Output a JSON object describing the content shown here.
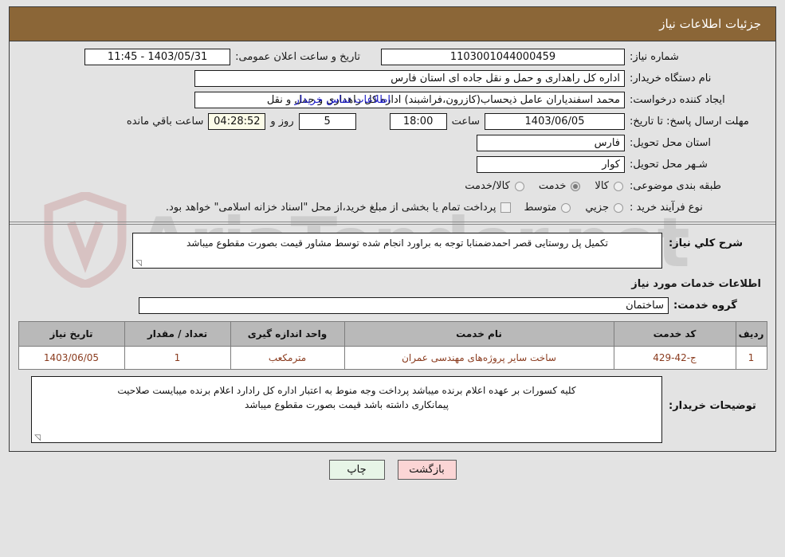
{
  "window": {
    "title": "جزئیات اطلاعات نیاز"
  },
  "info": {
    "need_number_label": "شماره نیاز:",
    "need_number_value": "1103001044000459",
    "public_announce_label": "تاریخ و ساعت اعلان عمومی:",
    "public_announce_value": "11:45 - 1403/05/31",
    "buyer_org_label": "نام دستگاه خریدار:",
    "buyer_org_value": "اداره کل راهداری و حمل و نقل جاده ای استان فارس",
    "requester_label": "ایجاد کننده درخواست:",
    "requester_value": "محمد اسفندیاران عامل ذیحساب(کازرون،فراشبند) اداره کل راهداری و حمل و نقل",
    "contact_link": "اطلاعات تماس خریدار",
    "deadline_label": "مهلت ارسال پاسخ: تا تاریخ:",
    "deadline_date": "1403/06/05",
    "deadline_time_label": "ساعت",
    "deadline_time": "18:00",
    "remaining_days": "5",
    "remaining_days_label": "روز و",
    "remaining_clock": "04:28:52",
    "remaining_suffix": "ساعت باقي مانده",
    "province_label": "استان محل تحویل:",
    "province_value": "فارس",
    "city_label": "شـهر محل تحویل:",
    "city_value": "کوار",
    "category_label": "طبقه بندی موضوعی:",
    "category_options": [
      {
        "label": "کالا",
        "selected": false
      },
      {
        "label": "خدمت",
        "selected": true
      },
      {
        "label": "کالا/خدمت",
        "selected": false
      }
    ],
    "process_label": "نوع فرآیند خرید :",
    "process_options": [
      {
        "label": "جزیي",
        "selected": false
      },
      {
        "label": "متوسط",
        "selected": false
      }
    ],
    "treasury_checkbox_checked": false,
    "treasury_note": "پرداخت تمام یا بخشی از مبلغ خرید،از محل \"اسناد خزانه اسلامی\" خواهد بود."
  },
  "general_desc": {
    "label": "شرح کلي نیاز:",
    "value": "تکمیل پل روستایی قصر احمدضمنابا توجه به براورد انجام شده توسط مشاور قیمت بصورت مقطوع میباشد"
  },
  "services": {
    "heading": "اطلاعات خدمات مورد نیاز",
    "group_label": "گروه خدمت:",
    "group_value": "ساختمان",
    "columns": [
      "ردیف",
      "کد خدمت",
      "نام خدمت",
      "واحد اندازه گیری",
      "تعداد / مقدار",
      "تاریخ نیاز"
    ],
    "rows": [
      {
        "index": "1",
        "code": "ج-42-429",
        "name": "ساخت سایر پروژه‌های مهندسی عمران",
        "unit": "مترمکعب",
        "quantity": "1",
        "need_date": "1403/06/05"
      }
    ]
  },
  "buyer_notes": {
    "label": "توضیحات خریدار:",
    "line1": "کلیه کسورات بر عهده اعلام برنده میباشد پرداخت وجه منوط به اعتبار اداره کل رادارد اعلام برنده میبایست صلاحیت",
    "line2": "پیمانکاری داشته باشد قیمت بصورت مقطوع میباشد"
  },
  "footer": {
    "print_label": "چاپ",
    "back_label": "بازگشت"
  },
  "watermark": {
    "text": "AriaTender.net"
  },
  "colors": {
    "header_brown": "#8b6637",
    "link_blue": "#1919c8",
    "row_text": "#8a3b1e",
    "print_bg": "#e7f5e7",
    "back_bg": "#fbd5d5",
    "timer_bg": "#fbfbe8"
  }
}
